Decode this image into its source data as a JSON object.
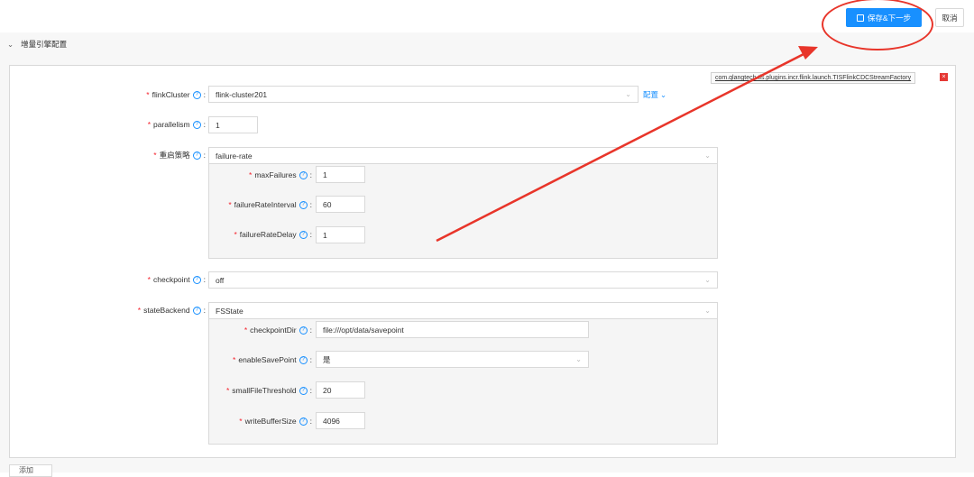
{
  "toolbar": {
    "save_next_label": "保存&下一步",
    "cancel_label": "取消"
  },
  "section": {
    "title": "增量引擎配置"
  },
  "plugin": {
    "class_name": "com.qlangtech.tis.plugins.incr.flink.launch.TISFlinkCDCStreamFactory",
    "close_symbol": "×"
  },
  "fields": {
    "flinkCluster": {
      "label": "flinkCluster",
      "value": "flink-cluster201",
      "config_link": "配置"
    },
    "parallelism": {
      "label": "parallelism",
      "value": "1"
    },
    "restartStrategy": {
      "label": "重启策略",
      "value": "failure-rate",
      "maxFailures": {
        "label": "maxFailures",
        "value": "1"
      },
      "failureRateInterval": {
        "label": "failureRateInterval",
        "value": "60"
      },
      "failureRateDelay": {
        "label": "failureRateDelay",
        "value": "1"
      }
    },
    "checkpoint": {
      "label": "checkpoint",
      "value": "off"
    },
    "stateBackend": {
      "label": "stateBackend",
      "value": "FSState",
      "checkpointDir": {
        "label": "checkpointDir",
        "value": "file:///opt/data/savepoint"
      },
      "enableSavePoint": {
        "label": "enableSavePoint",
        "value": "是"
      },
      "smallFileThreshold": {
        "label": "smallFileThreshold",
        "value": "20"
      },
      "writeBufferSize": {
        "label": "writeBufferSize",
        "value": "4096"
      }
    }
  },
  "bottom": {
    "add_label": "添加"
  },
  "common": {
    "required": "*",
    "help": "?",
    "colon": ":"
  },
  "colors": {
    "primary": "#1890ff",
    "annotation": "#e8352a",
    "required": "#f5222d"
  }
}
